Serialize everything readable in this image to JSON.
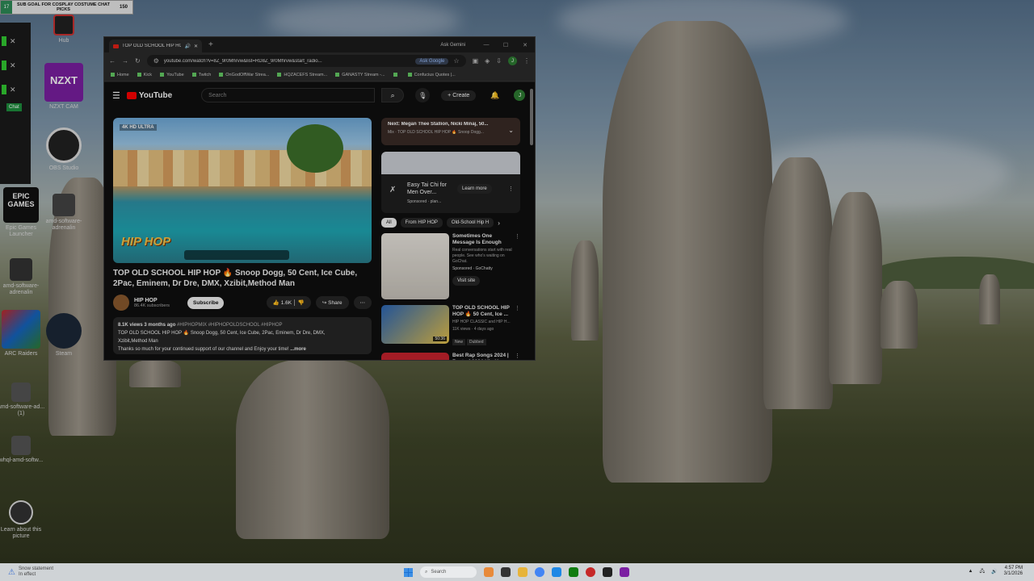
{
  "overlay": {
    "level": "17",
    "goal": "SUB GOAL FOR COSPLAY COSTUME CHAT PICKS",
    "count": "150"
  },
  "sidepanel": {
    "chat": "Chat"
  },
  "desktop_icons": [
    {
      "label": "Hub"
    },
    {
      "label": "NZXT CAM"
    },
    {
      "label": "OBS Studio"
    },
    {
      "label": "Epic Games Launcher"
    },
    {
      "label": "amd-software-adrenalin"
    },
    {
      "label": "amd-software-adrenalin"
    },
    {
      "label": "ARC Raiders"
    },
    {
      "label": "Steam"
    },
    {
      "label": "amd-software-ad... (1)"
    },
    {
      "label": "whql-amd-softw..."
    },
    {
      "label": "Learn about this picture"
    }
  ],
  "browser": {
    "tab_title": "TOP OLD SCHOOL HIP HO",
    "ask_gemini": "Ask Gemini",
    "url": "youtube.com/watch?v=8Z_9r0Mhrvw&list=RD8Z_9r0Mhrvw&start_radio...",
    "ask_google": "Ask Google",
    "profile_initial": "J",
    "bookmarks": [
      "Home",
      "Kick",
      "YouTube",
      "Twitch",
      "OnGodOffWar Strea...",
      "HQZACEFS Stream...",
      "GANASTY Stream -...",
      "",
      "Confucius Quotes |..."
    ]
  },
  "youtube": {
    "logo": "YouTube",
    "search_placeholder": "Search",
    "create": "Create",
    "avatar": "J",
    "player": {
      "badge": "4K HD ULTRA",
      "overlay_text": "HIP HOP"
    },
    "video_title": "TOP OLD SCHOOL HIP HOP 🔥 Snoop Dogg, 50 Cent, Ice Cube, 2Pac, Eminem, Dr Dre, DMX, Xzibit,Method Man",
    "channel": {
      "name": "HIP HOP",
      "subs": "86.4K subscribers"
    },
    "subscribe": "Subscribe",
    "likes": "1.6K",
    "share": "Share",
    "description": {
      "meta": "8.1K views  3 months ago",
      "tags": "#HIPHOPMIX #HIPHOPOLDSCHOOL #HIPHOP",
      "line1": "TOP OLD SCHOOL HIP HOP 🔥 Snoop Dogg, 50 Cent, Ice Cube, 2Pac, Eminem, Dr Dre, DMX,",
      "line2": "Xzibit,Method Man",
      "line3": "Thanks so much for your continued support of our channel and Enjoy your time!",
      "more": "...more"
    },
    "next": {
      "title": "Next: Megan Thee Stallion, Nicki Minaj, 50...",
      "sub": "Mix · TOP OLD SCHOOL HIP HOP 🔥 Snoop Dogg..."
    },
    "ad": {
      "title": "Easy Tai Chi for Men Over...",
      "sponsored": "Sponsored · plan...",
      "cta": "Learn more"
    },
    "chips": [
      "All",
      "From HIP HOP",
      "Old-School Hip H"
    ],
    "videos": [
      {
        "title": "Sometimes One Message Is Enough",
        "sub": "Real conversations start with real people. See who's waiting on GoChat.",
        "sponsored": "Sponsored · GoChatty",
        "cta": "Visit site"
      },
      {
        "title": "TOP OLD SCHOOL HIP HOP 🔥 50 Cent, Ice ...",
        "sub": "HIP HOP CLASSIC and HIP H...",
        "meta": "11K views · 4 days ago",
        "badges": [
          "New",
          "Dubbed"
        ],
        "duration": "50:36"
      },
      {
        "title": "Best Rap Songs 2024 | Best of 2024 Hip Ho...",
        "sub": ""
      }
    ]
  },
  "taskbar": {
    "weather_title": "Snow statement",
    "weather_sub": "In effect",
    "search": "Search",
    "time": "4:57 PM",
    "date": "3/1/2026"
  }
}
